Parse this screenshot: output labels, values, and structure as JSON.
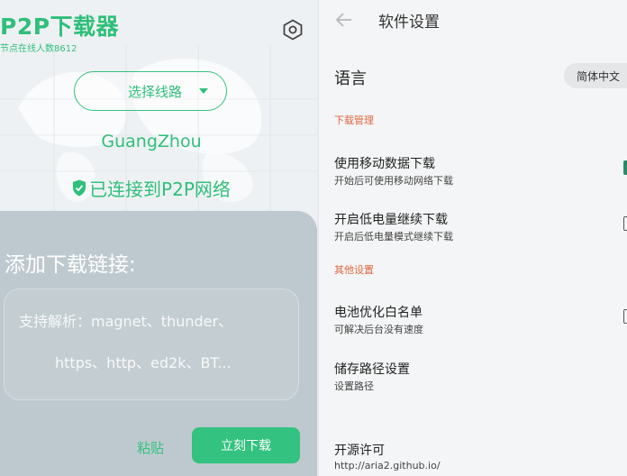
{
  "left": {
    "app_title": "P2P下载器",
    "online_nodes": "节点在线人数8612",
    "route_select_label": "选择线路",
    "city": "GuangZhou",
    "connection_status": "已连接到P2P网络",
    "add_link_title": "添加下载链接:",
    "link_placeholder_line1": "支持解析：magnet、thunder、",
    "link_placeholder_line2": "https、http、ed2k、BT...",
    "paste_label": "粘贴",
    "download_now_label": "立刻下载"
  },
  "right": {
    "title": "软件设置",
    "language_label": "语言",
    "language_value": "简体中文",
    "sections": [
      {
        "header": "下载管理",
        "items": [
          {
            "title": "使用移动数据下载",
            "subtitle": "开始后可使用移动网络下载",
            "checked": true
          },
          {
            "title": "开启低电量继续下载",
            "subtitle": "开启后低电量模式继续下载",
            "checked": false
          }
        ]
      },
      {
        "header": "其他设置",
        "items": [
          {
            "title": "电池优化白名单",
            "subtitle": "可解决后台没有速度",
            "checked": false
          },
          {
            "title": "储存路径设置",
            "subtitle": "设置路径"
          },
          {
            "title": "开源许可",
            "subtitle": "http://aria2.github.io/"
          }
        ]
      }
    ]
  },
  "colors": {
    "accent_green": "#33c27f",
    "section_orange": "#e0663d"
  }
}
